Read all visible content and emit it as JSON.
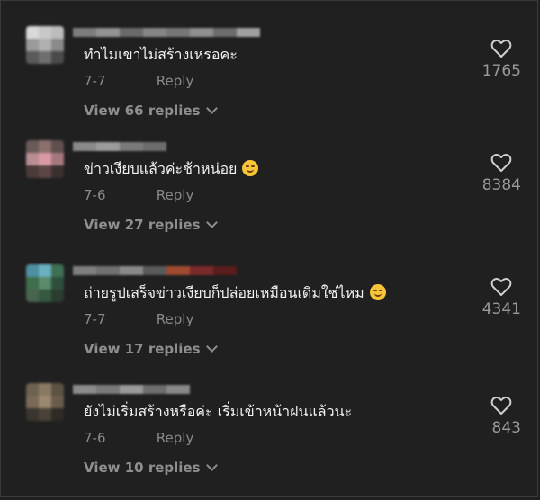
{
  "comments": [
    {
      "text": "ทำไมเขาไม่สร้างเหรอคะ",
      "date": "7-7",
      "reply_label": "Reply",
      "view_replies": "View 66 replies",
      "likes": "1765",
      "emoji": ""
    },
    {
      "text": "ข่าวเงียบแล้วค่ะช้าหน่อย",
      "date": "7-6",
      "reply_label": "Reply",
      "view_replies": "View 27 replies",
      "likes": "8384",
      "emoji": "😂"
    },
    {
      "text": "ถ่ายรูปเสร็จข่าวเงียบก็ปล่อยเหมือนเดิมใช่ไหม",
      "date": "7-7",
      "reply_label": "Reply",
      "view_replies": "View 17 replies",
      "likes": "4341",
      "emoji": "😅"
    },
    {
      "text": "ยังไม่เริ่มสร้างหรือค่ะ เริ่มเข้าหน้าฝนแล้วนะ",
      "date": "7-6",
      "reply_label": "Reply",
      "view_replies": "View 10 replies",
      "likes": "843",
      "emoji": ""
    }
  ],
  "colors": {
    "background": "#202020",
    "text": "#f2f2f2",
    "muted": "#8a8a8a"
  }
}
